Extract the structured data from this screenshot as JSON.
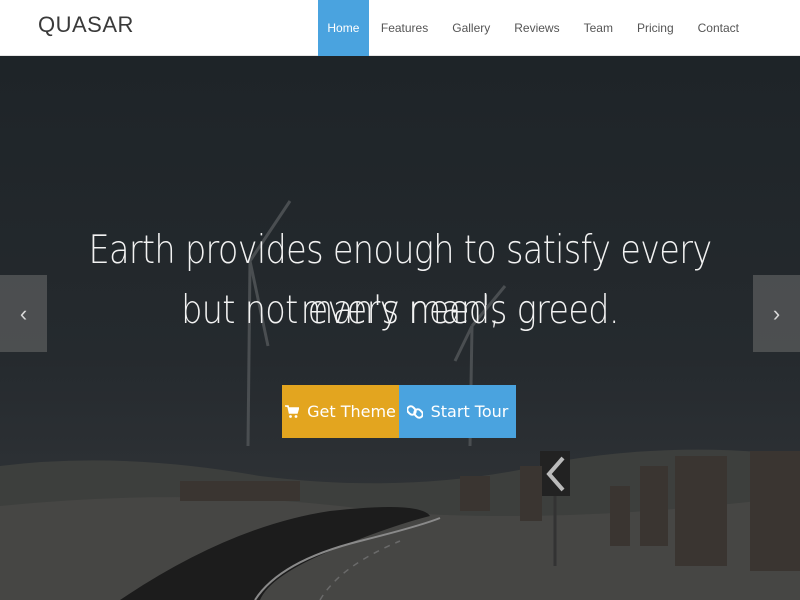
{
  "brand": "QUASAR",
  "nav": {
    "items": [
      "Home",
      "Features",
      "Gallery",
      "Reviews",
      "Team",
      "Pricing",
      "Contact"
    ],
    "active": "Home"
  },
  "hero": {
    "headline_line1": "Earth provides enough to satisfy every man's need,",
    "headline_line2": "but not every man's greed.",
    "primary_button": {
      "label": "Get Theme",
      "icon": "cart-icon",
      "color": "#e3a51f"
    },
    "secondary_button": {
      "label": "Start Tour",
      "icon": "link-icon",
      "color": "#4aa3df"
    },
    "prev_arrow": "‹",
    "next_arrow": "›"
  },
  "colors": {
    "accent": "#4aa3df",
    "warning": "#e3a51f"
  }
}
